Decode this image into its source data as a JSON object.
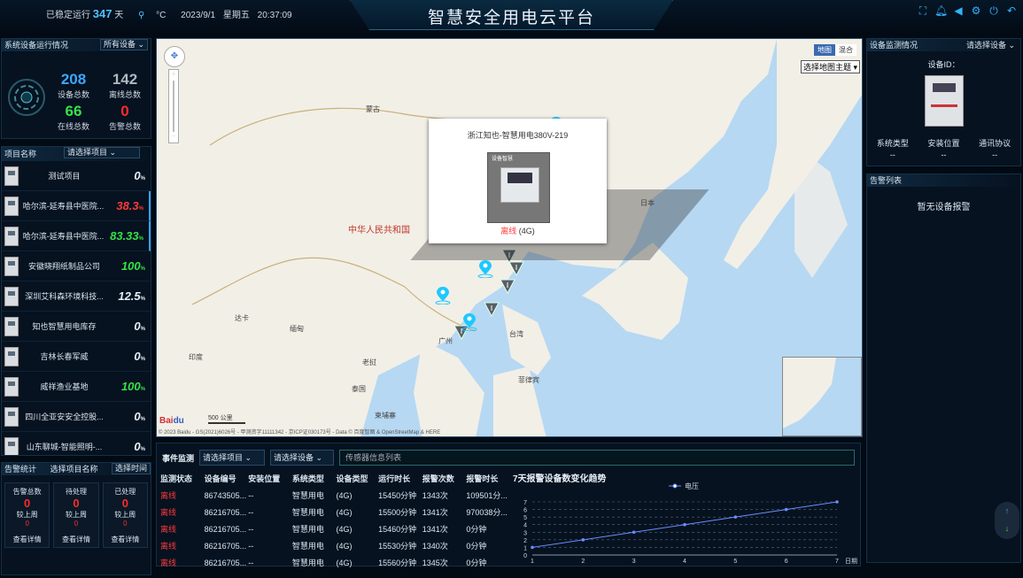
{
  "topbar": {
    "uptime_prefix": "已稳定运行",
    "uptime_days": "347",
    "uptime_unit": "天",
    "temp_unit": "°C",
    "date": "2023/9/1",
    "weekday": "星期五",
    "time": "20:37:09",
    "title": "智慧安全用电云平台",
    "icons": [
      "fullscreen-icon",
      "bell-icon",
      "volume-icon",
      "gear-icon",
      "power-icon",
      "back-icon"
    ]
  },
  "device_status": {
    "title": "系统设备运行情况",
    "filter": "所有设备",
    "total": "208",
    "total_label": "设备总数",
    "offline": "142",
    "offline_label": "离线总数",
    "online": "66",
    "online_label": "在线总数",
    "alarm": "0",
    "alarm_label": "告警总数"
  },
  "projects": {
    "header_label": "项目名称",
    "select": "请选择项目",
    "items": [
      {
        "name": "测试项目",
        "pct": "0",
        "color": "#e8f0f8"
      },
      {
        "name": "哈尔滨-延寿县中医院...",
        "pct": "38.3",
        "color": "#ff3a3a"
      },
      {
        "name": "哈尔滨-延寿县中医院...",
        "pct": "83.33",
        "color": "#38e04a"
      },
      {
        "name": "安徽晓翔纸制品公司",
        "pct": "100",
        "color": "#38e04a"
      },
      {
        "name": "深圳艾科森环境科技...",
        "pct": "12.5",
        "color": "#e8f0f8"
      },
      {
        "name": "知也智慧用电库存",
        "pct": "0",
        "color": "#e8f0f8"
      },
      {
        "name": "吉林长春军威",
        "pct": "0",
        "color": "#e8f0f8"
      },
      {
        "name": "威祥渔业基地",
        "pct": "100",
        "color": "#38e04a"
      },
      {
        "name": "四川全亚安安全控股...",
        "pct": "0",
        "color": "#e8f0f8"
      },
      {
        "name": "山东聊城-智能照明-...",
        "pct": "0",
        "color": "#e8f0f8"
      }
    ],
    "pct_suffix": "%"
  },
  "alarm_stats": {
    "title": "告警统计",
    "select1": "选择项目名称",
    "select2": "选择时间",
    "cards": [
      {
        "label": "告警总数",
        "value": "0",
        "cmp": "较上周",
        "cmp_val": "0",
        "link": "查看详情"
      },
      {
        "label": "待处理",
        "value": "0",
        "cmp": "较上周",
        "cmp_val": "0",
        "link": "查看详情"
      },
      {
        "label": "已处理",
        "value": "0",
        "cmp": "较上周",
        "cmp_val": "0",
        "link": "查看详情"
      }
    ]
  },
  "map": {
    "mode_map": "地图",
    "mode_hybrid": "混合",
    "theme_select": "选择地图主题",
    "labels": {
      "mongolia": "蒙古",
      "china": "中华人民共和国",
      "japan": "日本",
      "india": "印度",
      "laos": "老挝",
      "thailand": "泰国",
      "cambodia": "柬埔寨",
      "philippines": "菲律宾",
      "myanmar": "缅甸",
      "dhaka": "达卡",
      "taiwan": "台湾",
      "guangzhou": "广州"
    },
    "scale": "500 公里",
    "copyright": "© 2023 Baidu - GS(2021)6026号 - 甲测资字11111342 - 京ICP证030173号 - Data © 百度智图 & OpenStreetMap & HERE",
    "popup": {
      "title": "浙江知也-智慧用电380V-219",
      "img_caption": "设备智慧",
      "status": "离线",
      "net": "(4G)"
    }
  },
  "device_monitor": {
    "title": "设备监测情况",
    "select": "请选择设备",
    "id_label": "设备ID：",
    "cols": [
      "系统类型",
      "安装位置",
      "通讯协议"
    ],
    "vals": [
      "--",
      "--",
      "--"
    ]
  },
  "alarm_list": {
    "title": "告警列表",
    "empty": "暂无设备报警"
  },
  "events": {
    "title": "事件监测",
    "select_project": "请选择项目",
    "select_device": "请选择设备",
    "sensor_placeholder": "传感器信息列表",
    "headers": [
      "监测状态",
      "设备编号",
      "安装位置",
      "系统类型",
      "设备类型",
      "运行时长",
      "报警次数",
      "报警时长"
    ],
    "rows": [
      [
        "离线",
        "86743505...",
        "--",
        "智慧用电",
        "(4G)",
        "15450分钟",
        "1343次",
        "109501分..."
      ],
      [
        "离线",
        "86216705...",
        "--",
        "智慧用电",
        "(4G)",
        "15500分钟",
        "1341次",
        "970038分..."
      ],
      [
        "离线",
        "86216705...",
        "--",
        "智慧用电",
        "(4G)",
        "15460分钟",
        "1341次",
        "0分钟"
      ],
      [
        "离线",
        "86216705...",
        "--",
        "智慧用电",
        "(4G)",
        "15530分钟",
        "1340次",
        "0分钟"
      ],
      [
        "离线",
        "86216705...",
        "--",
        "智慧用电",
        "(4G)",
        "15560分钟",
        "1345次",
        "0分钟"
      ]
    ]
  },
  "chart_data": {
    "type": "line",
    "title": "7天报警设备数变化趋势",
    "series": [
      {
        "name": "电压",
        "values": [
          1,
          2,
          3,
          4,
          5,
          6,
          7
        ]
      }
    ],
    "x": [
      1,
      2,
      3,
      4,
      5,
      6,
      7
    ],
    "xlabel": "日期",
    "ylim": [
      0,
      7
    ],
    "yticks": [
      0,
      1,
      2,
      3,
      4,
      5,
      6,
      7
    ],
    "color": "#6a8cff",
    "legend_position": "top"
  }
}
